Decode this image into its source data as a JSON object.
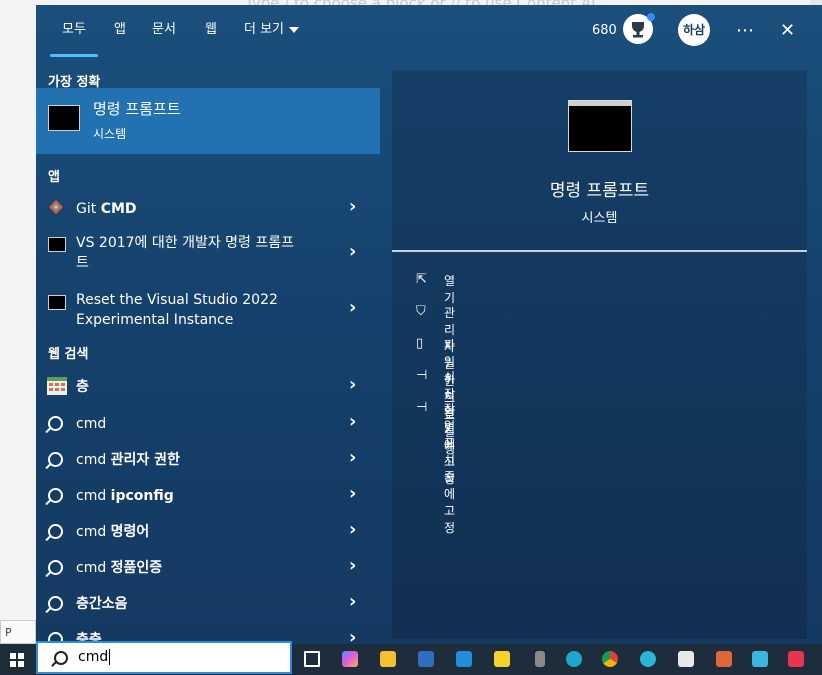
{
  "background": {
    "faint_text": "Type / to choose a block or // to use Content AI",
    "corner_box": "P"
  },
  "header": {
    "tabs": [
      {
        "label": "모두",
        "active": true
      },
      {
        "label": "앱",
        "active": false
      },
      {
        "label": "문서",
        "active": false
      },
      {
        "label": "웹",
        "active": false
      },
      {
        "label": "더 보기",
        "active": false
      }
    ],
    "points": "680",
    "avatar_text": "하삼자",
    "more_label": "⋯",
    "close_label": "✕"
  },
  "left": {
    "best_match_heading": "가장 정확",
    "best_match": {
      "title": "명령 프롬프트",
      "subtitle": "시스템"
    },
    "apps_heading": "앱",
    "apps": [
      {
        "icon": "git-icon",
        "label_plain": "Git ",
        "label_bold": "CMD"
      },
      {
        "icon": "cmd-icon",
        "line1": "VS 2017에 대한 개발자 명령 프롬프",
        "line2": "트"
      },
      {
        "icon": "cmd-icon",
        "line1": "Reset the Visual Studio 2022",
        "line2": "Experimental Instance"
      }
    ],
    "web_heading": "웹 검색",
    "web": [
      {
        "icon": "web-image-icon",
        "prefix": "",
        "bold": "층"
      },
      {
        "icon": "search-icon",
        "prefix": "cmd",
        "bold": ""
      },
      {
        "icon": "search-icon",
        "prefix": "cmd ",
        "bold": "관리자 권한"
      },
      {
        "icon": "search-icon",
        "prefix": "cmd ",
        "bold": "ipconfig"
      },
      {
        "icon": "search-icon",
        "prefix": "cmd ",
        "bold": "명령어"
      },
      {
        "icon": "search-icon",
        "prefix": "cmd ",
        "bold": "정품인증"
      },
      {
        "icon": "search-icon",
        "prefix": "",
        "bold": "층간소음"
      },
      {
        "icon": "search-icon",
        "prefix": "",
        "bold": "층층"
      }
    ]
  },
  "right": {
    "title": "명령 프롬프트",
    "subtitle": "시스템",
    "actions": [
      {
        "icon": "open-icon",
        "label": "열기"
      },
      {
        "icon": "shield-icon",
        "label": "관리자 권한으로 실행"
      },
      {
        "icon": "file-location-icon",
        "label": "파일 위치 열기"
      },
      {
        "icon": "pin-icon",
        "label": "시작 화면에 고정"
      },
      {
        "icon": "pin-icon",
        "label": "작업 표시줄에 고정"
      }
    ]
  },
  "taskbar": {
    "search_value": "cmd"
  },
  "colors": {
    "panel": "#1b4f7c",
    "selected": "#2271b1",
    "accent": "#4cc2ff",
    "taskbar": "#1e2d3c"
  }
}
